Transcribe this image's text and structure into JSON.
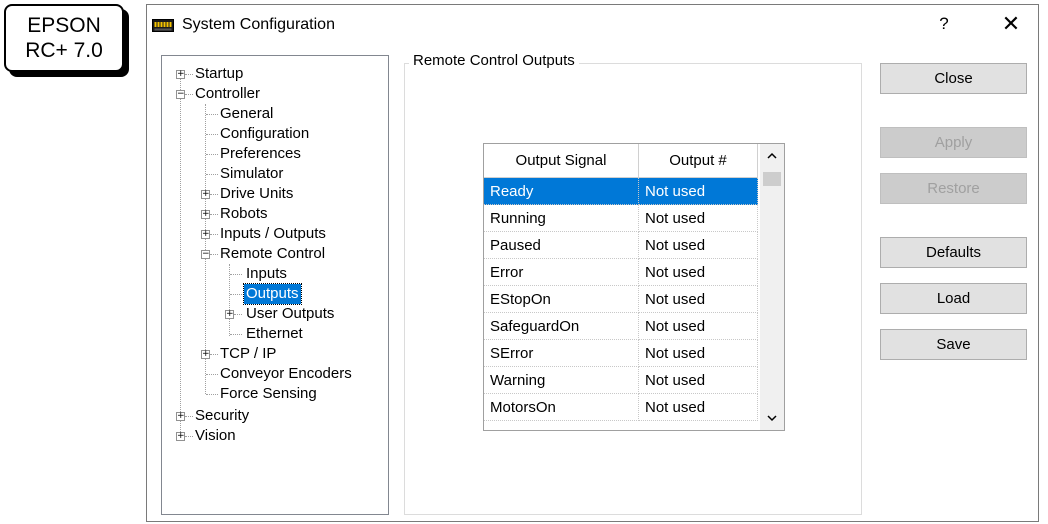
{
  "badge": {
    "line1": "EPSON",
    "line2": "RC+ 7.0"
  },
  "window": {
    "title": "System Configuration",
    "help": "?",
    "close": "✕"
  },
  "tree": {
    "startup": "Startup",
    "controller": "Controller",
    "general": "General",
    "configuration": "Configuration",
    "preferences": "Preferences",
    "simulator": "Simulator",
    "drive_units": "Drive Units",
    "robots": "Robots",
    "inputs_outputs": "Inputs / Outputs",
    "remote_control": "Remote Control",
    "inputs": "Inputs",
    "outputs": "Outputs",
    "user_outputs": "User Outputs",
    "ethernet": "Ethernet",
    "tcp_ip": "TCP / IP",
    "conveyor_encoders": "Conveyor Encoders",
    "force_sensing": "Force Sensing",
    "security": "Security",
    "vision": "Vision"
  },
  "group": {
    "title": "Remote Control Outputs"
  },
  "table": {
    "headers": [
      "Output Signal",
      "Output #"
    ],
    "rows": [
      [
        "Ready",
        "Not used"
      ],
      [
        "Running",
        "Not used"
      ],
      [
        "Paused",
        "Not used"
      ],
      [
        "Error",
        "Not used"
      ],
      [
        "EStopOn",
        "Not used"
      ],
      [
        "SafeguardOn",
        "Not used"
      ],
      [
        "SError",
        "Not used"
      ],
      [
        "Warning",
        "Not used"
      ],
      [
        "MotorsOn",
        "Not used"
      ]
    ]
  },
  "buttons": {
    "close": "Close",
    "apply": "Apply",
    "restore": "Restore",
    "defaults": "Defaults",
    "load": "Load",
    "save": "Save"
  },
  "icons": {
    "expander_collapsed": "+",
    "expander_expanded": "−",
    "scroll_up": "^",
    "scroll_down": "v"
  }
}
